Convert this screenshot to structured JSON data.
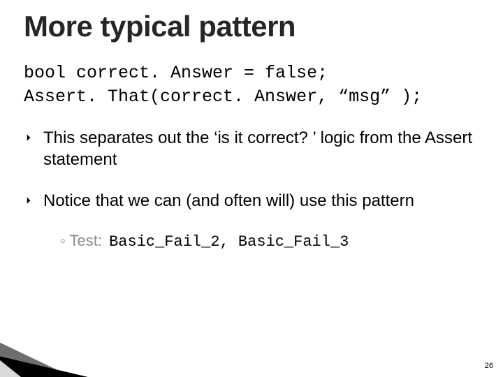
{
  "title": "More typical pattern",
  "code": {
    "line1": "bool correct. Answer = false;",
    "line2": "Assert. That(correct. Answer, “msg” );"
  },
  "bullets": [
    "This separates out the ‘is it correct? ’ logic from the Assert statement",
    "Notice that we can (and often will) use this pattern"
  ],
  "subitem": {
    "prefix": "◦ Test: ",
    "mono": "Basic_Fail_2, Basic_Fail_3"
  },
  "page_number": "26"
}
